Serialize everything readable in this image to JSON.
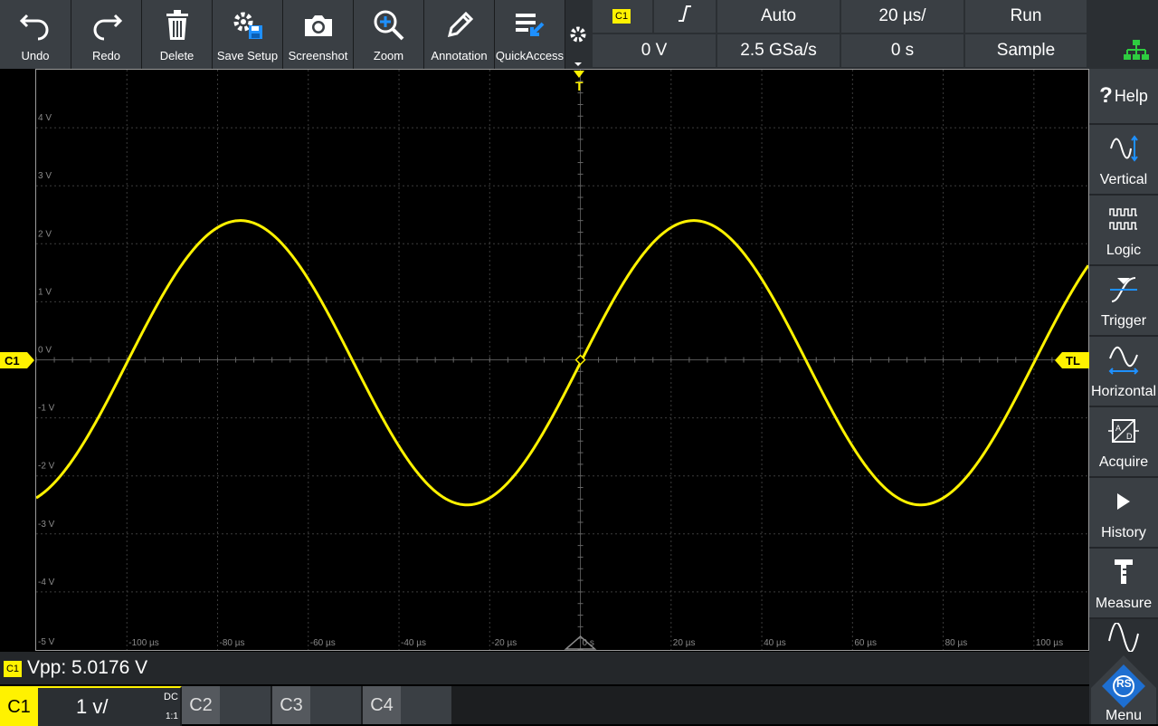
{
  "toolbar": {
    "buttons": [
      {
        "label": "Undo",
        "icon": "undo-arrow-icon"
      },
      {
        "label": "Redo",
        "icon": "redo-arrow-icon"
      },
      {
        "label": "Delete",
        "icon": "trash-icon"
      },
      {
        "label": "Save Setup",
        "icon": "save-setup-icon"
      },
      {
        "label": "Screenshot",
        "icon": "camera-icon"
      },
      {
        "label": "Zoom",
        "icon": "zoom-in-icon"
      },
      {
        "label": "Annotation",
        "icon": "pencil-icon"
      },
      {
        "label": "QuickAccess",
        "icon": "quick-access-icon"
      }
    ]
  },
  "info": {
    "trigger_source": "C1",
    "trigger_level": "0 V",
    "trigger_mode": "Auto",
    "sample_rate": "2.5 GSa/s",
    "timebase": "20 µs/",
    "horizontal_position": "0 s",
    "run_state": "Run",
    "acquire_mode": "Sample"
  },
  "right_panel": {
    "help": "Help",
    "items": [
      {
        "label": "Vertical",
        "icon": "vertical-icon"
      },
      {
        "label": "Logic",
        "icon": "logic-icon"
      },
      {
        "label": "Trigger",
        "icon": "trigger-icon"
      },
      {
        "label": "Horizontal",
        "icon": "horizontal-icon"
      },
      {
        "label": "Acquire",
        "icon": "acquire-icon"
      },
      {
        "label": "History",
        "icon": "play-icon"
      },
      {
        "label": "Measure",
        "icon": "caliper-icon"
      }
    ],
    "menu": "Menu"
  },
  "markers": {
    "channel": "C1",
    "trigger_level": "TL",
    "trigger_position": "T"
  },
  "measurement": {
    "channel": "C1",
    "text": "Vpp: 5.0176 V"
  },
  "channels": [
    {
      "name": "C1",
      "scale": "1 v/",
      "coupling": "DC",
      "ratio": "1:1",
      "active": true
    },
    {
      "name": "C2",
      "active": false
    },
    {
      "name": "C3",
      "active": false
    },
    {
      "name": "C4",
      "active": false
    }
  ],
  "colors": {
    "trace": "#fff200",
    "grid": "#3c3c3c",
    "axis_label": "#8a8a8a",
    "toolbar": "#3a3f44",
    "accent_blue": "#1e90ff"
  },
  "chart_data": {
    "type": "line",
    "xlabel": "",
    "ylabel": "",
    "x_unit": "µs",
    "y_unit": "V",
    "xlim": [
      -120,
      112
    ],
    "ylim": [
      -5,
      5
    ],
    "x_tick_labels": [
      "-100 µs",
      "-80 µs",
      "-60 µs",
      "-40 µs",
      "-20 µs",
      "0 s",
      "20 µs",
      "40 µs",
      "60 µs",
      "80 µs",
      "100 µs"
    ],
    "x_ticks": [
      -100,
      -80,
      -60,
      -40,
      -20,
      0,
      20,
      40,
      60,
      80,
      100
    ],
    "y_tick_labels": [
      "4 V",
      "3 V",
      "2 V",
      "1 V",
      "0 V",
      "-1 V",
      "-2 V",
      "-3 V",
      "-4 V",
      "-5 V"
    ],
    "y_ticks": [
      4,
      3,
      2,
      1,
      0,
      -1,
      -2,
      -3,
      -4,
      -5
    ],
    "series": [
      {
        "name": "C1",
        "amplitude": 2.45,
        "period": 100,
        "phase_zero_crossing": 0,
        "offset": -0.05
      }
    ],
    "grid": true
  }
}
